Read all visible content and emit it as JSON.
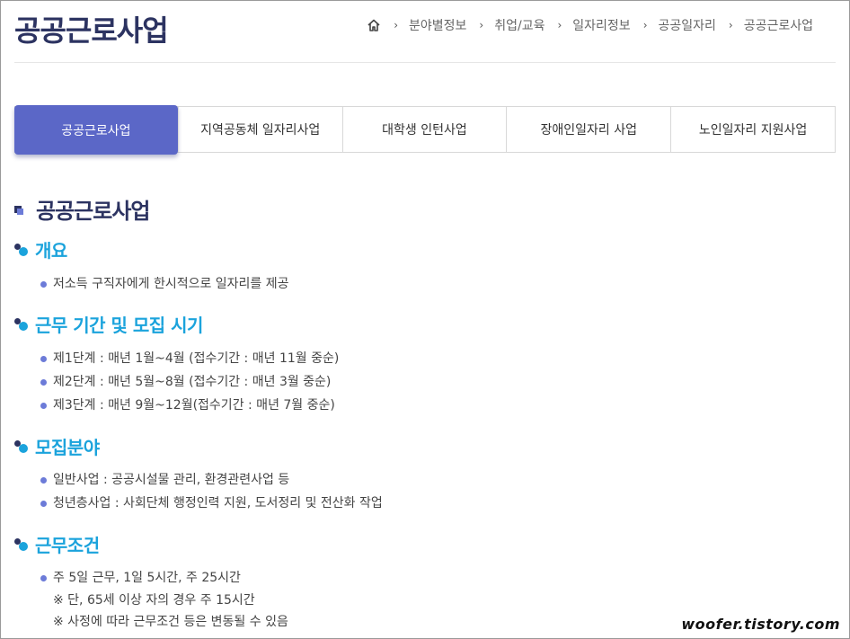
{
  "page_title": "공공근로사업",
  "breadcrumb": {
    "home_icon": "home-icon",
    "items": [
      "분야별정보",
      "취업/교육",
      "일자리정보",
      "공공일자리",
      "공공근로사업"
    ],
    "separator": "›"
  },
  "tabs": [
    {
      "label": "공공근로사업",
      "active": true
    },
    {
      "label": "지역공동체 일자리사업",
      "active": false
    },
    {
      "label": "대학생 인턴사업",
      "active": false
    },
    {
      "label": "장애인일자리 사업",
      "active": false
    },
    {
      "label": "노인일자리 지원사업",
      "active": false
    }
  ],
  "content": {
    "heading": "공공근로사업",
    "sections": [
      {
        "title": "개요",
        "items": [
          "저소득 구직자에게 한시적으로 일자리를 제공"
        ]
      },
      {
        "title": "근무 기간 및 모집 시기",
        "items": [
          "제1단계 : 매년 1월~4월 (접수기간 : 매년 11월 중순)",
          "제2단계 : 매년 5월~8월 (접수기간 : 매년 3월 중순)",
          "제3단계 : 매년 9월~12월(접수기간 : 매년 7월 중순)"
        ]
      },
      {
        "title": "모집분야",
        "items": [
          "일반사업 : 공공시설물 관리, 환경관련사업 등",
          "청년층사업 : 사회단체 행정인력 지원, 도서정리 및 전산화 작업"
        ]
      },
      {
        "title": "근무조건",
        "items": [
          "주 5일 근무, 1일 5시간, 주 25시간"
        ],
        "notes": [
          "※ 단, 65세 이상 자의 경우 주 15시간",
          "※ 사정에 따라 근무조건 등은 변동될 수 있음"
        ]
      }
    ]
  },
  "watermark": "woofer.tistory.com",
  "colors": {
    "title": "#2c3361",
    "accent": "#1ba3dc",
    "tab_active": "#5b67c7",
    "bullet": "#6c7bd8"
  }
}
